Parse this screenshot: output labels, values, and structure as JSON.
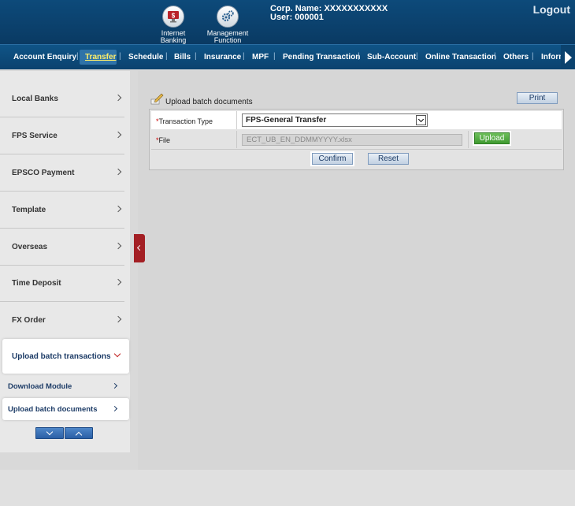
{
  "header": {
    "icons": [
      {
        "label_line1": "Internet",
        "label_line2": "Banking",
        "icon": "monitor-dollar-icon"
      },
      {
        "label_line1": "Management",
        "label_line2": "Function",
        "icon": "gears-icon"
      }
    ],
    "corp_label": "Corp. Name:",
    "corp_value": "XXXXXXXXXXX",
    "user_label": "User:",
    "user_value": "000001",
    "logout": "Logout"
  },
  "nav": {
    "items": [
      "Account Enquiry",
      "Transfer",
      "Schedule",
      "Bills",
      "Insurance",
      "MPF",
      "Pending Transaction",
      "Sub-Account",
      "Online Transaction",
      "Others",
      "Inform"
    ],
    "active": "Transfer"
  },
  "sidebar": {
    "items": [
      "Local Banks",
      "FPS Service",
      "EPSCO Payment",
      "Template",
      "Overseas",
      "Time Deposit",
      "FX Order"
    ],
    "open_item": "Upload batch transactions",
    "sub_items": [
      "Download Module",
      "Upload batch documents"
    ],
    "selected_sub": "Upload batch documents"
  },
  "page": {
    "title": "Upload batch documents",
    "print_label": "Print",
    "form": {
      "transaction_type_label": "Transaction Type",
      "transaction_type_value": "FPS-General Transfer",
      "file_label": "File",
      "file_value": "ECT_UB_EN_DDMMYYYY.xlsx",
      "upload_label": "Upload",
      "required_mark": "*"
    },
    "confirm_label": "Confirm",
    "reset_label": "Reset"
  },
  "colors": {
    "header": "#0d4a7a",
    "active_nav_text": "#ffef6a",
    "collapse_tab": "#a31f24",
    "upload_button": "#4fa83c"
  }
}
